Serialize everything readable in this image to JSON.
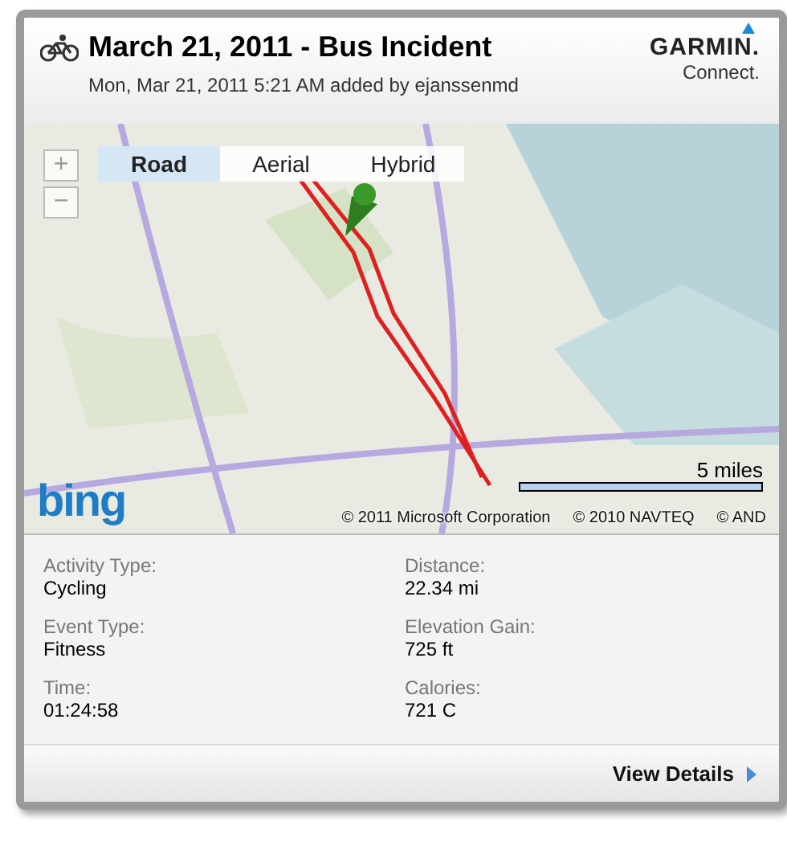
{
  "header": {
    "title": "March 21, 2011 - Bus Incident",
    "subtitle": "Mon, Mar 21, 2011 5:21 AM added by ejanssenmd",
    "logo": {
      "brand": "GARMIN.",
      "product": "Connect."
    }
  },
  "map": {
    "kind": "picture",
    "zoom_buttons": [
      "+",
      "−"
    ],
    "map_types": [
      {
        "label": "Road",
        "selected": true
      },
      {
        "label": "Aerial",
        "selected": false
      },
      {
        "label": "Hybrid",
        "selected": false
      }
    ],
    "scale": "5 miles",
    "provider": "bing",
    "credits": [
      "© 2011 Microsoft Corporation",
      "© 2010 NAVTEQ",
      "© AND"
    ]
  },
  "stats": [
    {
      "label": "Activity Type:",
      "value": "Cycling"
    },
    {
      "label": "Distance:",
      "value": "22.34 mi"
    },
    {
      "label": "Event Type:",
      "value": "Fitness"
    },
    {
      "label": "Elevation Gain:",
      "value": "725 ft"
    },
    {
      "label": "Time:",
      "value": "01:24:58"
    },
    {
      "label": "Calories:",
      "value": "721 C"
    }
  ],
  "footer": {
    "link": "View Details"
  }
}
